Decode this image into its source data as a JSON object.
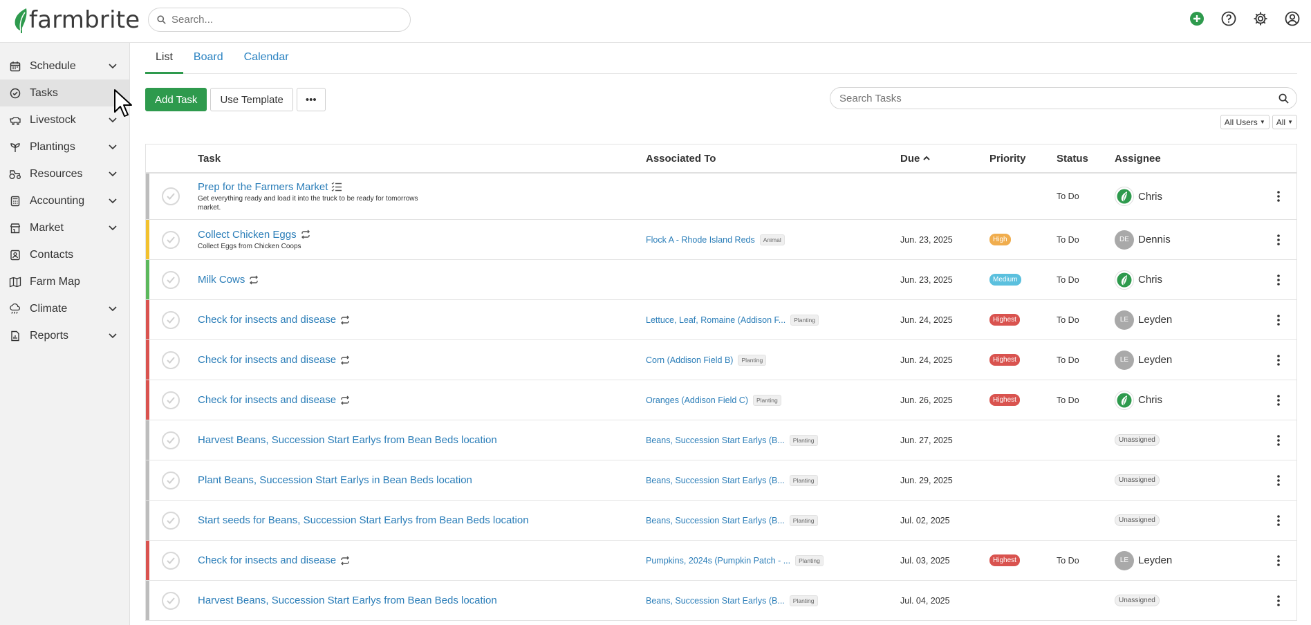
{
  "app": {
    "logo_text": "farmbrite",
    "brand_color": "#2e9a4d",
    "link_color": "#2a7db8"
  },
  "header": {
    "search_placeholder": "Search...",
    "icons": [
      "add-circle-icon",
      "help-icon",
      "gear-icon",
      "user-icon"
    ]
  },
  "sidebar": {
    "items": [
      {
        "label": "Schedule",
        "icon": "calendar-icon",
        "expandable": true
      },
      {
        "label": "Tasks",
        "icon": "check-circle-icon",
        "expandable": false,
        "active": true
      },
      {
        "label": "Livestock",
        "icon": "cow-icon",
        "expandable": true
      },
      {
        "label": "Plantings",
        "icon": "sprout-icon",
        "expandable": true
      },
      {
        "label": "Resources",
        "icon": "tractor-icon",
        "expandable": true
      },
      {
        "label": "Accounting",
        "icon": "calculator-icon",
        "expandable": true
      },
      {
        "label": "Market",
        "icon": "store-icon",
        "expandable": true
      },
      {
        "label": "Contacts",
        "icon": "contact-card-icon",
        "expandable": false
      },
      {
        "label": "Farm Map",
        "icon": "map-icon",
        "expandable": false
      },
      {
        "label": "Climate",
        "icon": "cloud-rain-icon",
        "expandable": true
      },
      {
        "label": "Reports",
        "icon": "report-icon",
        "expandable": true
      }
    ]
  },
  "tabs": [
    {
      "label": "List",
      "active": true
    },
    {
      "label": "Board",
      "active": false
    },
    {
      "label": "Calendar",
      "active": false
    }
  ],
  "toolbar": {
    "add_task": "Add Task",
    "use_template": "Use Template",
    "more": "•••"
  },
  "search_tasks": {
    "placeholder": "Search Tasks"
  },
  "filters": {
    "users": "All Users",
    "all": "All"
  },
  "table": {
    "headers": {
      "task": "Task",
      "associated": "Associated To",
      "due": "Due",
      "priority": "Priority",
      "status": "Status",
      "assignee": "Assignee"
    },
    "rows": [
      {
        "bar": "#bdbdbd",
        "name": "Prep for the Farmers Market",
        "icon": "checklist-icon",
        "desc": "Get everything ready and load it into the truck to be ready for tomorrows market.",
        "assoc": "",
        "tag": "",
        "due": "",
        "priority": "",
        "status": "To Do",
        "assignee": "Chris",
        "avatar": "logo"
      },
      {
        "bar": "#f2c12e",
        "name": "Collect Chicken Eggs",
        "icon": "repeat-icon",
        "desc": "Collect Eggs from Chicken Coops",
        "assoc": "Flock A - Rhode Island Reds",
        "tag": "Animal",
        "due": "Jun. 23, 2025",
        "priority": "High",
        "status": "To Do",
        "assignee": "Dennis",
        "avatar": "DE"
      },
      {
        "bar": "#5cb85c",
        "name": "Milk Cows",
        "icon": "repeat-icon",
        "desc": "",
        "assoc": "",
        "tag": "",
        "due": "Jun. 23, 2025",
        "priority": "Medium",
        "status": "To Do",
        "assignee": "Chris",
        "avatar": "logo"
      },
      {
        "bar": "#d9534f",
        "name": "Check for insects and disease",
        "icon": "repeat-icon",
        "desc": "",
        "assoc": "Lettuce, Leaf, Romaine (Addison F...",
        "tag": "Planting",
        "due": "Jun. 24, 2025",
        "priority": "Highest",
        "status": "To Do",
        "assignee": "Leyden",
        "avatar": "LE"
      },
      {
        "bar": "#d9534f",
        "name": "Check for insects and disease",
        "icon": "repeat-icon",
        "desc": "",
        "assoc": "Corn (Addison Field B)",
        "tag": "Planting",
        "due": "Jun. 24, 2025",
        "priority": "Highest",
        "status": "To Do",
        "assignee": "Leyden",
        "avatar": "LE"
      },
      {
        "bar": "#d9534f",
        "name": "Check for insects and disease",
        "icon": "repeat-icon",
        "desc": "",
        "assoc": "Oranges (Addison Field C)",
        "tag": "Planting",
        "due": "Jun. 26, 2025",
        "priority": "Highest",
        "status": "To Do",
        "assignee": "Chris",
        "avatar": "logo"
      },
      {
        "bar": "#bdbdbd",
        "name": "Harvest Beans, Succession Start Earlys from Bean Beds location",
        "icon": "",
        "desc": "",
        "assoc": "Beans, Succession Start Earlys (B...",
        "tag": "Planting",
        "due": "Jun. 27, 2025",
        "priority": "",
        "status": "",
        "assignee": "Unassigned",
        "avatar": "none"
      },
      {
        "bar": "#bdbdbd",
        "name": "Plant Beans, Succession Start Earlys in Bean Beds location",
        "icon": "",
        "desc": "",
        "assoc": "Beans, Succession Start Earlys (B...",
        "tag": "Planting",
        "due": "Jun. 29, 2025",
        "priority": "",
        "status": "",
        "assignee": "Unassigned",
        "avatar": "none"
      },
      {
        "bar": "#bdbdbd",
        "name": "Start seeds for Beans, Succession Start Earlys from Bean Beds location",
        "icon": "",
        "desc": "",
        "assoc": "Beans, Succession Start Earlys (B...",
        "tag": "Planting",
        "due": "Jul. 02, 2025",
        "priority": "",
        "status": "",
        "assignee": "Unassigned",
        "avatar": "none"
      },
      {
        "bar": "#d9534f",
        "name": "Check for insects and disease",
        "icon": "repeat-icon",
        "desc": "",
        "assoc": "Pumpkins, 2024s (Pumpkin Patch - ...",
        "tag": "Planting",
        "due": "Jul. 03, 2025",
        "priority": "Highest",
        "status": "To Do",
        "assignee": "Leyden",
        "avatar": "LE"
      },
      {
        "bar": "#bdbdbd",
        "name": "Harvest Beans, Succession Start Earlys from Bean Beds location",
        "icon": "",
        "desc": "",
        "assoc": "Beans, Succession Start Earlys (B...",
        "tag": "Planting",
        "due": "Jul. 04, 2025",
        "priority": "",
        "status": "",
        "assignee": "Unassigned",
        "avatar": "none"
      }
    ]
  },
  "priority_colors": {
    "High": "#f0ad4e",
    "Medium": "#5bc0de",
    "Highest": "#d9534f"
  }
}
